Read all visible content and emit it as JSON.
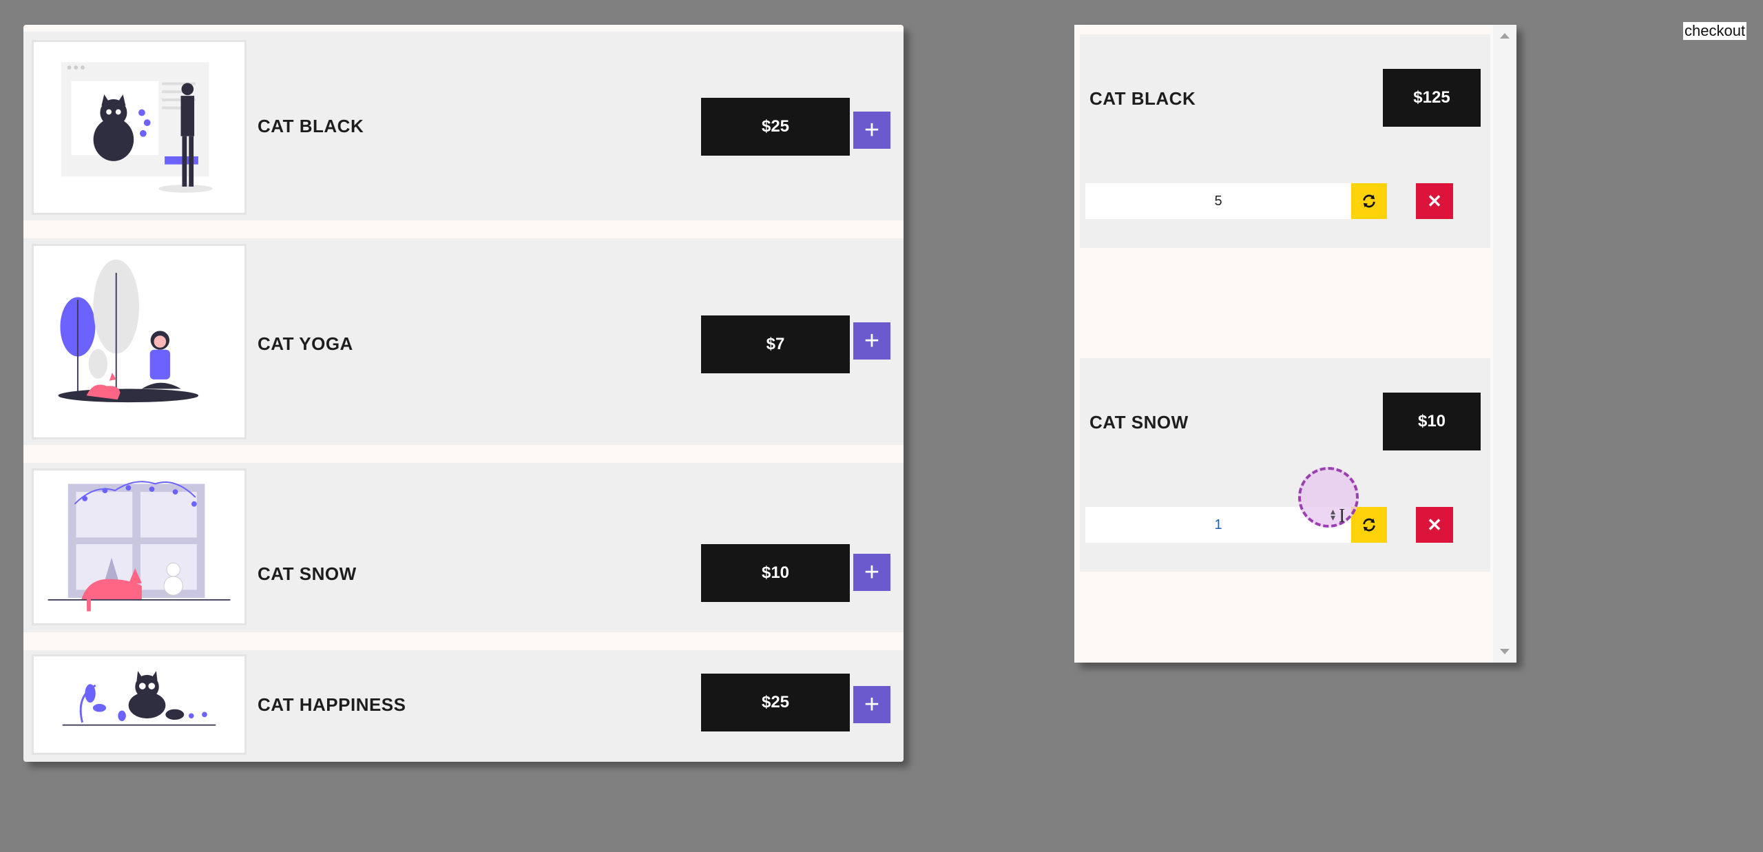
{
  "products": [
    {
      "name": "CAT BLACK",
      "price": "$25",
      "add_label": "+",
      "image_icon": "cat-black-illustration"
    },
    {
      "name": "CAT YOGA",
      "price": "$7",
      "add_label": "+",
      "image_icon": "cat-yoga-illustration"
    },
    {
      "name": "CAT SNOW",
      "price": "$10",
      "add_label": "+",
      "image_icon": "cat-snow-illustration"
    },
    {
      "name": "CAT HAPPINESS",
      "price": "$25",
      "add_label": "+",
      "image_icon": "cat-happiness-illustration"
    }
  ],
  "cart": {
    "items": [
      {
        "name": "CAT BLACK",
        "price": "$125",
        "quantity": "5",
        "refresh_icon": "refresh-icon",
        "remove_label": "✕"
      },
      {
        "name": "CAT SNOW",
        "price": "$10",
        "quantity": "1",
        "refresh_icon": "refresh-icon",
        "remove_label": "✕"
      }
    ]
  },
  "checkout_label": "checkout",
  "colors": {
    "background": "#808080",
    "accent_add": "#6a5acd",
    "price_box": "#151515",
    "refresh": "#ffd20a",
    "remove": "#dc143c",
    "illustration_purple": "#6c63ff",
    "illustration_pink": "#ff6584"
  }
}
